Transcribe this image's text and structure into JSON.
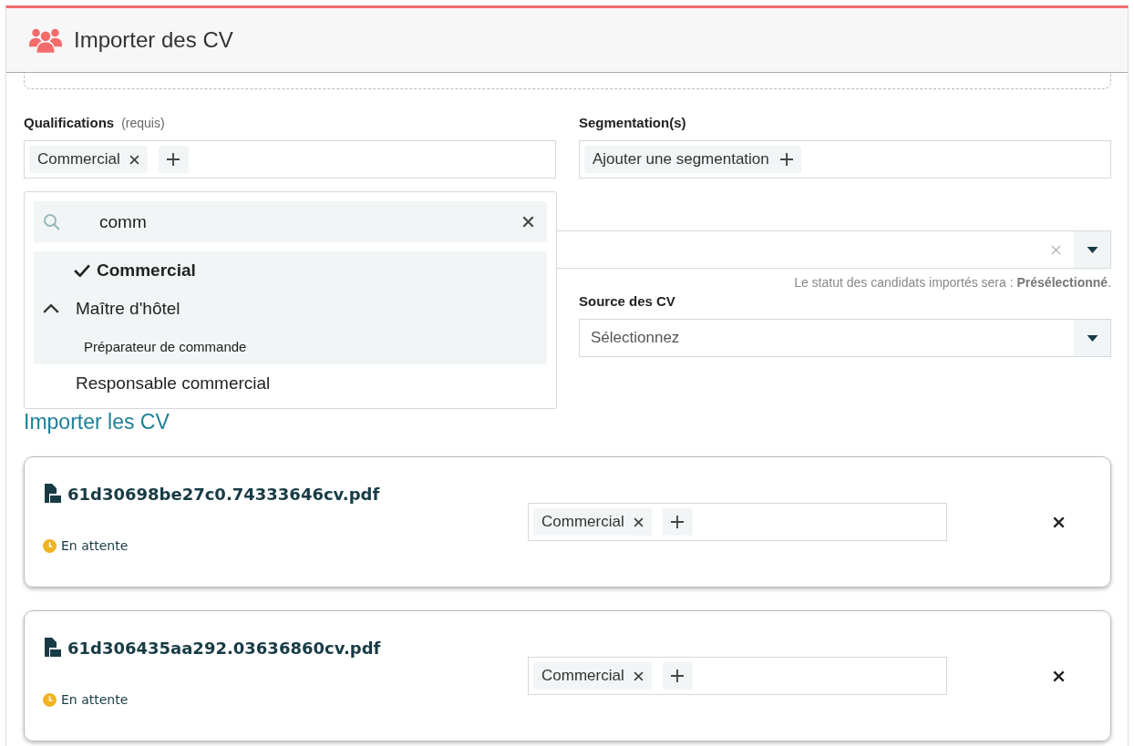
{
  "header": {
    "title": "Importer des CV"
  },
  "qualifications": {
    "label": "Qualifications",
    "hint": "(requis)",
    "tags": [
      {
        "label": "Commercial"
      }
    ]
  },
  "segmentation": {
    "label": "Segmentation(s)",
    "add_label": "Ajouter une segmentation"
  },
  "status_field": {
    "note": "Le statut des candidats importés sera : **Présélectionné**."
  },
  "source": {
    "label": "Source des CV",
    "placeholder": "Sélectionnez"
  },
  "dropdown": {
    "search": "comm",
    "options": [
      {
        "label": "Commercial",
        "selected": true,
        "expanded": false
      },
      {
        "label": "Maître d'hôtel",
        "selected": false,
        "expanded": true,
        "children": [
          {
            "label": "Préparateur de commande",
            "selected": false
          }
        ]
      },
      {
        "label": "Responsable commercial",
        "selected": false,
        "expanded": false
      }
    ]
  },
  "import_heading": "Importer les CV",
  "files": [
    {
      "name": "61d30698be27c0.74333646cv.pdf",
      "status": "En attente",
      "tags": [
        {
          "label": "Commercial"
        }
      ]
    },
    {
      "name": "61d306435aa292.03636860cv.pdf",
      "status": "En attente",
      "tags": [
        {
          "label": "Commercial"
        }
      ]
    }
  ]
}
